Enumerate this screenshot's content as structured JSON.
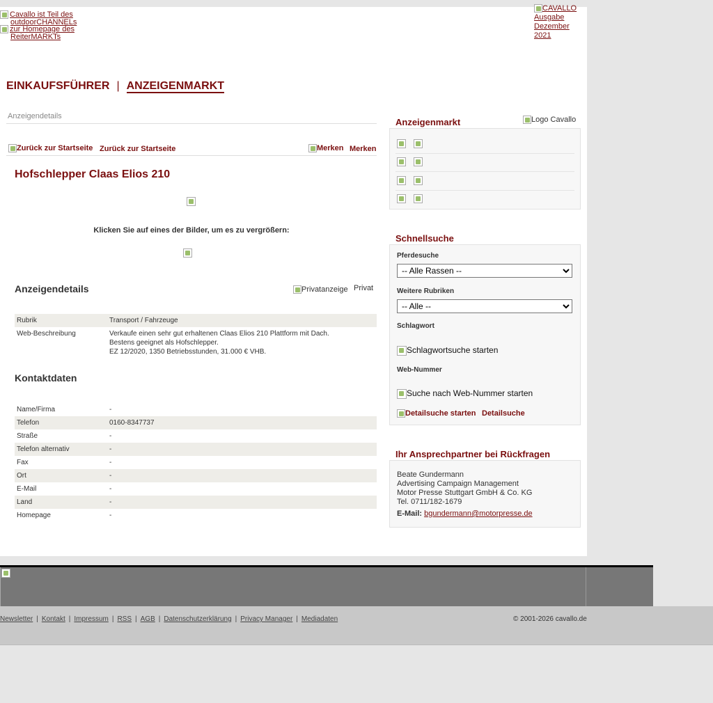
{
  "header": {
    "outdoor_link": "Cavallo ist Teil des outdoorCHANNELs",
    "reitermarkt_link": "zur Homepage des ReiterMARKTs",
    "issue_link": "CAVALLO Ausgabe Dezember 2021"
  },
  "nav": {
    "item1": "EINKAUFSFÜHRER",
    "separator": "|",
    "item2": "ANZEIGENMARKT"
  },
  "breadcrumb": "Anzeigendetails",
  "toolbar": {
    "back_alt": "Zurück zur Startseite",
    "back_label": "Zurück zur Startseite",
    "remember_alt": "Merken",
    "remember_label": "Merken"
  },
  "ad": {
    "title": "Hofschlepper Claas Elios 210",
    "click_hint": "Klicken Sie auf eines der Bilder, um es zu vergrößern:",
    "details_heading": "Anzeigendetails",
    "private_alt": "Privatanzeige",
    "private_label": "Privat",
    "details": [
      {
        "label": "Rubrik",
        "value": "Transport / Fahrzeuge"
      },
      {
        "label": "Web-Beschreibung",
        "value_lines": [
          "Verkaufe einen sehr gut erhaltenen Claas Elios 210 Plattform mit Dach.",
          "Bestens geeignet als Hofschlepper.",
          "EZ 12/2020, 1350 Betriebsstunden, 31.000 € VHB."
        ]
      }
    ],
    "contact_heading": "Kontaktdaten",
    "contact": [
      {
        "label": "Name/Firma",
        "value": "-"
      },
      {
        "label": "Telefon",
        "value": "0160-8347737"
      },
      {
        "label": "Straße",
        "value": "-"
      },
      {
        "label": "Telefon alternativ",
        "value": "-"
      },
      {
        "label": "Fax",
        "value": "-"
      },
      {
        "label": "Ort",
        "value": "-"
      },
      {
        "label": "E-Mail",
        "value": "-"
      },
      {
        "label": "Land",
        "value": "-"
      },
      {
        "label": "Homepage",
        "value": "-"
      }
    ]
  },
  "sidebar": {
    "market_heading": "Anzeigenmarkt",
    "logo_alt": "Logo Cavallo",
    "quick_heading": "Schnellsuche",
    "horse_label": "Pferdesuche",
    "horse_select": "-- Alle Rassen --",
    "more_label": "Weitere Rubriken",
    "more_select": "-- Alle --",
    "keyword_label": "Schlagwort",
    "keyword_button": "Schlagwortsuche starten",
    "webnr_label": "Web-Nummer",
    "webnr_button": "Suche nach Web-Nummer starten",
    "detail_alt": "Detailsuche starten",
    "detail_label": "Detailsuche",
    "contact_heading": "Ihr Ansprechpartner bei Rückfragen",
    "contact_name": "Beate Gundermann",
    "contact_role": "Advertising Campaign Management",
    "contact_company": "Motor Presse Stuttgart GmbH & Co. KG",
    "contact_phone": "Tel. 0711/182-1679",
    "contact_email_label": "E-Mail:",
    "contact_email": "bgundermann@motorpresse.de"
  },
  "footer": {
    "links": [
      "Newsletter",
      "Kontakt",
      "Impressum",
      "RSS",
      "AGB",
      "Datenschutzerklärung",
      "Privacy Manager",
      "Mediadaten"
    ],
    "separator": "|",
    "copyright": "© 2001-2026 cavallo.de"
  }
}
